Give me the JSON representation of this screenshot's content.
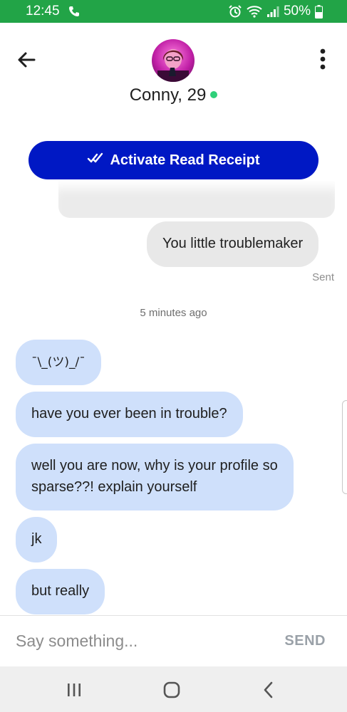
{
  "status_bar": {
    "time": "12:45",
    "battery": "50%",
    "icons": [
      "phone-call-icon",
      "alarm-icon",
      "wifi-icon",
      "signal-icon",
      "battery-icon"
    ]
  },
  "header": {
    "contact_name": "Conny, 29",
    "online": true,
    "icons": [
      "back-arrow-icon",
      "more-vertical-icon"
    ]
  },
  "read_receipt_button": {
    "label": "Activate Read Receipt",
    "icon": "double-check-icon"
  },
  "conversation": {
    "outgoing": [
      {
        "text": "You little troublemaker",
        "status": "Sent"
      }
    ],
    "timestamp": "5 minutes ago",
    "incoming": [
      {
        "text": "¯\\_(ツ)_/¯"
      },
      {
        "text": "have you ever been in trouble?"
      },
      {
        "text": "well you are now, why is your profile so sparse??! explain yourself"
      },
      {
        "text": "jk"
      },
      {
        "text": "but really"
      }
    ]
  },
  "composer": {
    "placeholder": "Say something...",
    "value": "",
    "send_label": "SEND"
  },
  "nav_bar": {
    "icons": [
      "recent-apps-icon",
      "home-icon",
      "nav-back-icon"
    ]
  },
  "colors": {
    "status_bar": "#22a447",
    "accent": "#0018c4",
    "incoming_bubble": "#cfe0fb",
    "outgoing_bubble": "#e8e8e8",
    "online": "#2fd07a"
  }
}
